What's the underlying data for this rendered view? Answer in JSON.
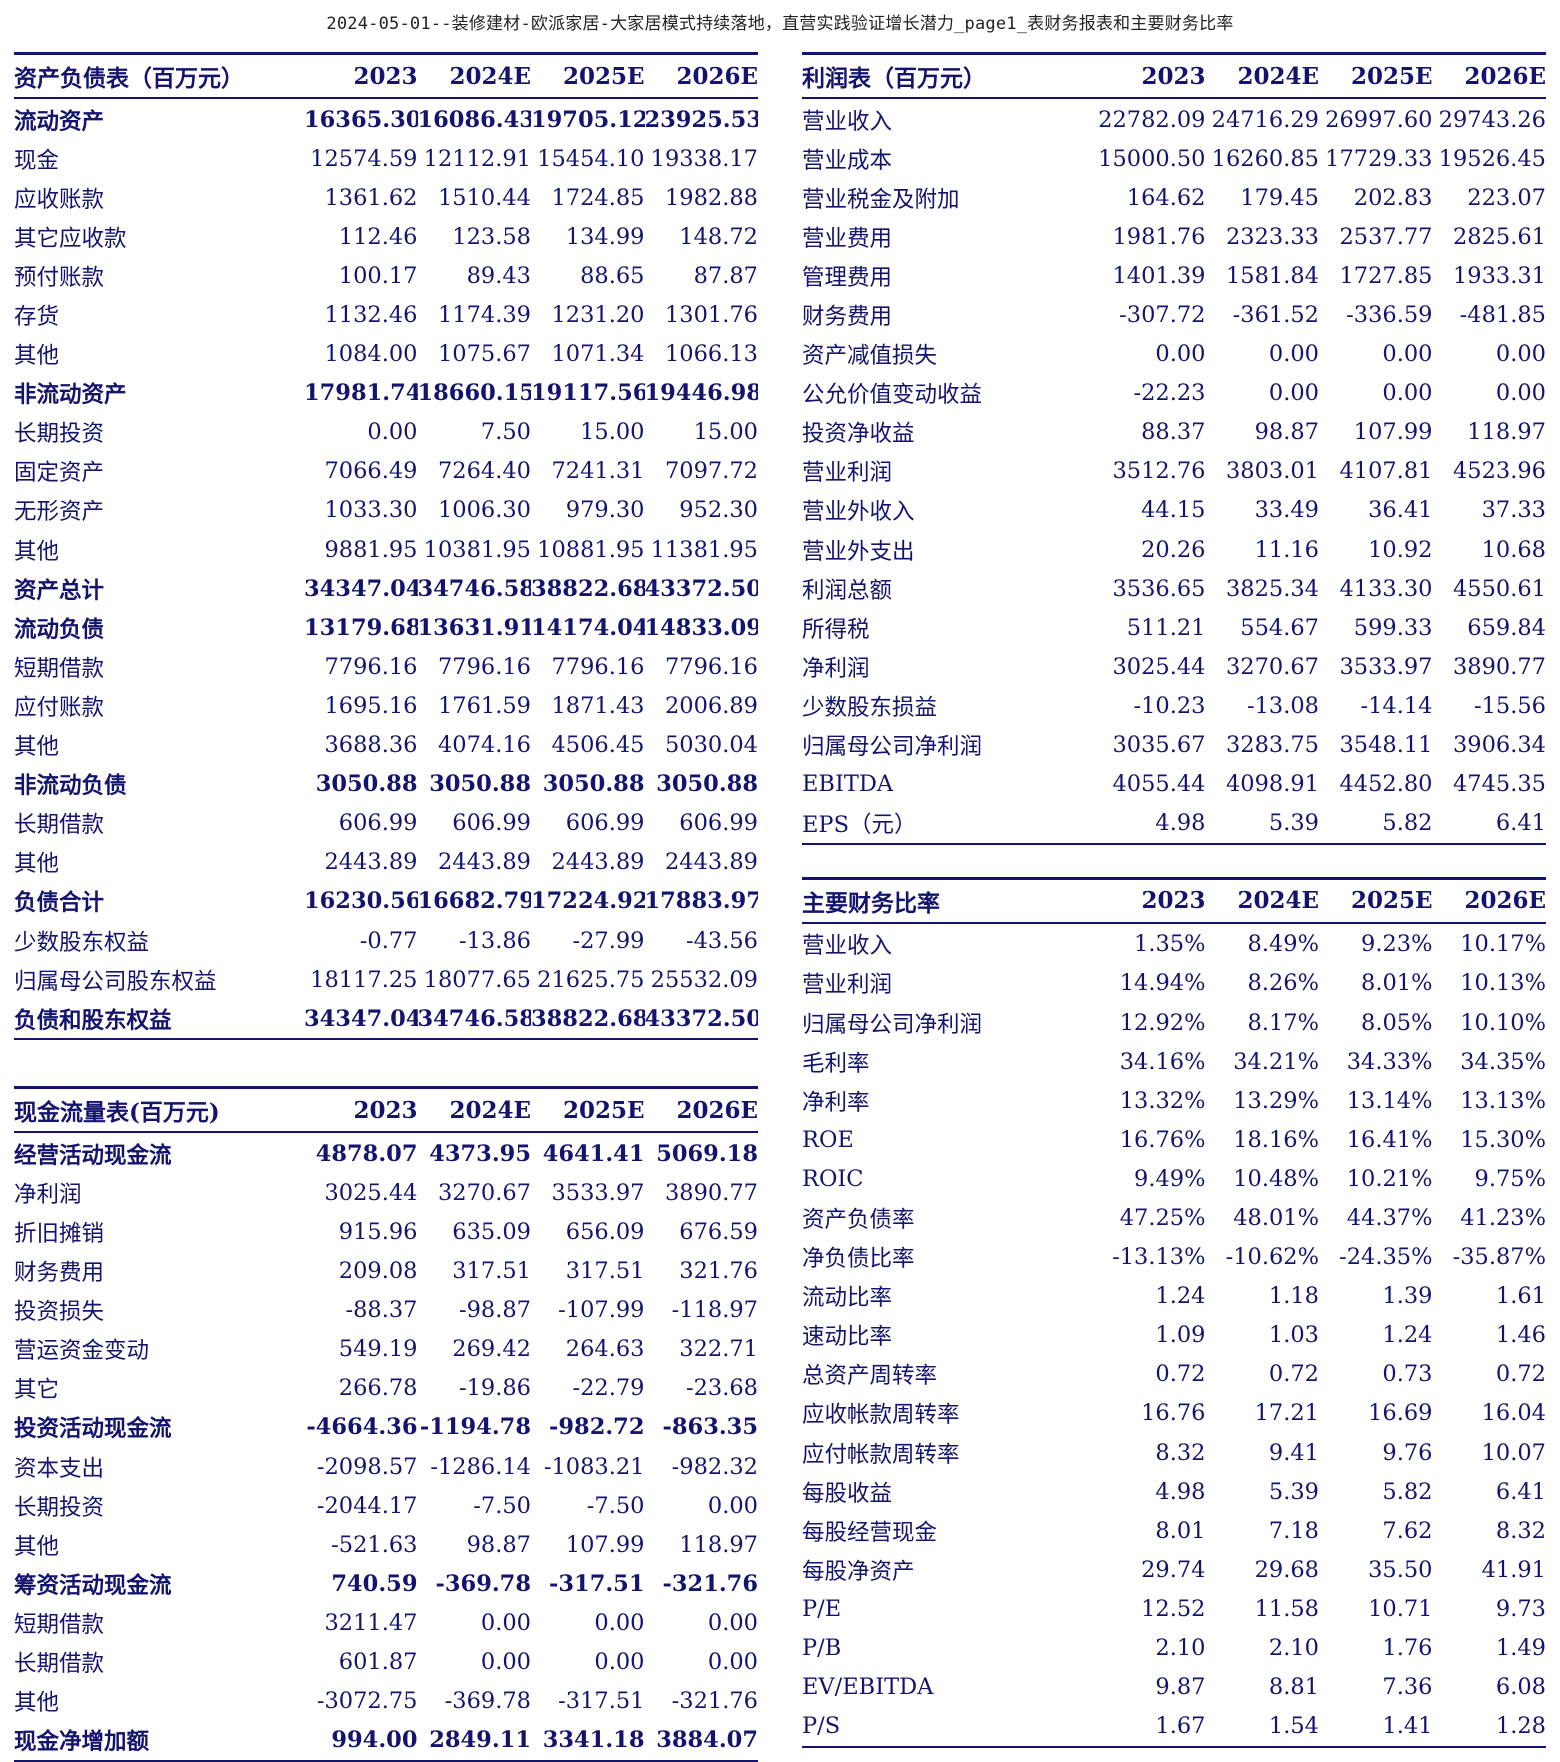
{
  "page_title": "2024-05-01--装修建材-欧派家居-大家居模式持续落地，直营实践验证增长潜力_page1_表财务报表和主要财务比率",
  "balance_sheet": {
    "title": "资产负债表（百万元）",
    "years": [
      "2023",
      "2024E",
      "2025E",
      "2026E"
    ],
    "rows": [
      {
        "label": "流动资产",
        "bold": true,
        "values": [
          "16365.30",
          "16086.43",
          "19705.12",
          "23925.53"
        ]
      },
      {
        "label": "现金",
        "bold": false,
        "values": [
          "12574.59",
          "12112.91",
          "15454.10",
          "19338.17"
        ]
      },
      {
        "label": "应收账款",
        "bold": false,
        "values": [
          "1361.62",
          "1510.44",
          "1724.85",
          "1982.88"
        ]
      },
      {
        "label": "其它应收款",
        "bold": false,
        "values": [
          "112.46",
          "123.58",
          "134.99",
          "148.72"
        ]
      },
      {
        "label": "预付账款",
        "bold": false,
        "values": [
          "100.17",
          "89.43",
          "88.65",
          "87.87"
        ]
      },
      {
        "label": "存货",
        "bold": false,
        "values": [
          "1132.46",
          "1174.39",
          "1231.20",
          "1301.76"
        ]
      },
      {
        "label": "其他",
        "bold": false,
        "values": [
          "1084.00",
          "1075.67",
          "1071.34",
          "1066.13"
        ]
      },
      {
        "label": "非流动资产",
        "bold": true,
        "values": [
          "17981.74",
          "18660.15",
          "19117.56",
          "19446.98"
        ]
      },
      {
        "label": "长期投资",
        "bold": false,
        "values": [
          "0.00",
          "7.50",
          "15.00",
          "15.00"
        ]
      },
      {
        "label": "固定资产",
        "bold": false,
        "values": [
          "7066.49",
          "7264.40",
          "7241.31",
          "7097.72"
        ]
      },
      {
        "label": "无形资产",
        "bold": false,
        "values": [
          "1033.30",
          "1006.30",
          "979.30",
          "952.30"
        ]
      },
      {
        "label": "其他",
        "bold": false,
        "values": [
          "9881.95",
          "10381.95",
          "10881.95",
          "11381.95"
        ]
      },
      {
        "label": "资产总计",
        "bold": true,
        "values": [
          "34347.04",
          "34746.58",
          "38822.68",
          "43372.50"
        ]
      },
      {
        "label": "流动负债",
        "bold": true,
        "values": [
          "13179.68",
          "13631.91",
          "14174.04",
          "14833.09"
        ]
      },
      {
        "label": "短期借款",
        "bold": false,
        "values": [
          "7796.16",
          "7796.16",
          "7796.16",
          "7796.16"
        ]
      },
      {
        "label": "应付账款",
        "bold": false,
        "values": [
          "1695.16",
          "1761.59",
          "1871.43",
          "2006.89"
        ]
      },
      {
        "label": "其他",
        "bold": false,
        "values": [
          "3688.36",
          "4074.16",
          "4506.45",
          "5030.04"
        ]
      },
      {
        "label": "非流动负债",
        "bold": true,
        "values": [
          "3050.88",
          "3050.88",
          "3050.88",
          "3050.88"
        ]
      },
      {
        "label": "长期借款",
        "bold": false,
        "values": [
          "606.99",
          "606.99",
          "606.99",
          "606.99"
        ]
      },
      {
        "label": "其他",
        "bold": false,
        "values": [
          "2443.89",
          "2443.89",
          "2443.89",
          "2443.89"
        ]
      },
      {
        "label": "负债合计",
        "bold": true,
        "values": [
          "16230.56",
          "16682.79",
          "17224.92",
          "17883.97"
        ]
      },
      {
        "label": "少数股东权益",
        "bold": false,
        "values": [
          "-0.77",
          "-13.86",
          "-27.99",
          "-43.56"
        ]
      },
      {
        "label": "归属母公司股东权益",
        "bold": false,
        "values": [
          "18117.25",
          "18077.65",
          "21625.75",
          "25532.09"
        ]
      },
      {
        "label": "负债和股东权益",
        "bold": true,
        "values": [
          "34347.04",
          "34746.58",
          "38822.68",
          "43372.50"
        ]
      }
    ]
  },
  "cash_flow": {
    "title": "现金流量表(百万元)",
    "years": [
      "2023",
      "2024E",
      "2025E",
      "2026E"
    ],
    "rows": [
      {
        "label": "经营活动现金流",
        "bold": true,
        "values": [
          "4878.07",
          "4373.95",
          "4641.41",
          "5069.18"
        ]
      },
      {
        "label": "净利润",
        "bold": false,
        "values": [
          "3025.44",
          "3270.67",
          "3533.97",
          "3890.77"
        ]
      },
      {
        "label": "折旧摊销",
        "bold": false,
        "values": [
          "915.96",
          "635.09",
          "656.09",
          "676.59"
        ]
      },
      {
        "label": "财务费用",
        "bold": false,
        "values": [
          "209.08",
          "317.51",
          "317.51",
          "321.76"
        ]
      },
      {
        "label": "投资损失",
        "bold": false,
        "values": [
          "-88.37",
          "-98.87",
          "-107.99",
          "-118.97"
        ]
      },
      {
        "label": "营运资金变动",
        "bold": false,
        "values": [
          "549.19",
          "269.42",
          "264.63",
          "322.71"
        ]
      },
      {
        "label": "其它",
        "bold": false,
        "values": [
          "266.78",
          "-19.86",
          "-22.79",
          "-23.68"
        ]
      },
      {
        "label": "投资活动现金流",
        "bold": true,
        "values": [
          "-4664.36",
          "-1194.78",
          "-982.72",
          "-863.35"
        ]
      },
      {
        "label": "资本支出",
        "bold": false,
        "values": [
          "-2098.57",
          "-1286.14",
          "-1083.21",
          "-982.32"
        ]
      },
      {
        "label": "长期投资",
        "bold": false,
        "values": [
          "-2044.17",
          "-7.50",
          "-7.50",
          "0.00"
        ]
      },
      {
        "label": "其他",
        "bold": false,
        "values": [
          "-521.63",
          "98.87",
          "107.99",
          "118.97"
        ]
      },
      {
        "label": "筹资活动现金流",
        "bold": true,
        "values": [
          "740.59",
          "-369.78",
          "-317.51",
          "-321.76"
        ]
      },
      {
        "label": "短期借款",
        "bold": false,
        "values": [
          "3211.47",
          "0.00",
          "0.00",
          "0.00"
        ]
      },
      {
        "label": "长期借款",
        "bold": false,
        "values": [
          "601.87",
          "0.00",
          "0.00",
          "0.00"
        ]
      },
      {
        "label": "其他",
        "bold": false,
        "values": [
          "-3072.75",
          "-369.78",
          "-317.51",
          "-321.76"
        ]
      },
      {
        "label": "现金净增加额",
        "bold": true,
        "values": [
          "994.00",
          "2849.11",
          "3341.18",
          "3884.07"
        ]
      }
    ]
  },
  "income_statement": {
    "title": "利润表（百万元）",
    "years": [
      "2023",
      "2024E",
      "2025E",
      "2026E"
    ],
    "rows": [
      {
        "label": "营业收入",
        "bold": false,
        "values": [
          "22782.09",
          "24716.29",
          "26997.60",
          "29743.26"
        ]
      },
      {
        "label": "营业成本",
        "bold": false,
        "values": [
          "15000.50",
          "16260.85",
          "17729.33",
          "19526.45"
        ]
      },
      {
        "label": "营业税金及附加",
        "bold": false,
        "values": [
          "164.62",
          "179.45",
          "202.83",
          "223.07"
        ]
      },
      {
        "label": "营业费用",
        "bold": false,
        "values": [
          "1981.76",
          "2323.33",
          "2537.77",
          "2825.61"
        ]
      },
      {
        "label": "管理费用",
        "bold": false,
        "values": [
          "1401.39",
          "1581.84",
          "1727.85",
          "1933.31"
        ]
      },
      {
        "label": "财务费用",
        "bold": false,
        "values": [
          "-307.72",
          "-361.52",
          "-336.59",
          "-481.85"
        ]
      },
      {
        "label": "资产减值损失",
        "bold": false,
        "values": [
          "0.00",
          "0.00",
          "0.00",
          "0.00"
        ]
      },
      {
        "label": "公允价值变动收益",
        "bold": false,
        "values": [
          "-22.23",
          "0.00",
          "0.00",
          "0.00"
        ]
      },
      {
        "label": "投资净收益",
        "bold": false,
        "values": [
          "88.37",
          "98.87",
          "107.99",
          "118.97"
        ]
      },
      {
        "label": "营业利润",
        "bold": false,
        "values": [
          "3512.76",
          "3803.01",
          "4107.81",
          "4523.96"
        ]
      },
      {
        "label": "营业外收入",
        "bold": false,
        "values": [
          "44.15",
          "33.49",
          "36.41",
          "37.33"
        ]
      },
      {
        "label": "营业外支出",
        "bold": false,
        "values": [
          "20.26",
          "11.16",
          "10.92",
          "10.68"
        ]
      },
      {
        "label": "利润总额",
        "bold": false,
        "values": [
          "3536.65",
          "3825.34",
          "4133.30",
          "4550.61"
        ]
      },
      {
        "label": "所得税",
        "bold": false,
        "values": [
          "511.21",
          "554.67",
          "599.33",
          "659.84"
        ]
      },
      {
        "label": "净利润",
        "bold": false,
        "values": [
          "3025.44",
          "3270.67",
          "3533.97",
          "3890.77"
        ]
      },
      {
        "label": "少数股东损益",
        "bold": false,
        "values": [
          "-10.23",
          "-13.08",
          "-14.14",
          "-15.56"
        ]
      },
      {
        "label": "归属母公司净利润",
        "bold": false,
        "values": [
          "3035.67",
          "3283.75",
          "3548.11",
          "3906.34"
        ]
      },
      {
        "label": "EBITDA",
        "bold": false,
        "values": [
          "4055.44",
          "4098.91",
          "4452.80",
          "4745.35"
        ]
      },
      {
        "label": "EPS（元）",
        "bold": false,
        "values": [
          "4.98",
          "5.39",
          "5.82",
          "6.41"
        ]
      }
    ]
  },
  "ratios": {
    "title": "主要财务比率",
    "years": [
      "2023",
      "2024E",
      "2025E",
      "2026E"
    ],
    "rows": [
      {
        "label": "营业收入",
        "bold": false,
        "values": [
          "1.35%",
          "8.49%",
          "9.23%",
          "10.17%"
        ]
      },
      {
        "label": "营业利润",
        "bold": false,
        "values": [
          "14.94%",
          "8.26%",
          "8.01%",
          "10.13%"
        ]
      },
      {
        "label": "归属母公司净利润",
        "bold": false,
        "values": [
          "12.92%",
          "8.17%",
          "8.05%",
          "10.10%"
        ]
      },
      {
        "label": "毛利率",
        "bold": false,
        "values": [
          "34.16%",
          "34.21%",
          "34.33%",
          "34.35%"
        ]
      },
      {
        "label": "净利率",
        "bold": false,
        "values": [
          "13.32%",
          "13.29%",
          "13.14%",
          "13.13%"
        ]
      },
      {
        "label": "ROE",
        "bold": false,
        "values": [
          "16.76%",
          "18.16%",
          "16.41%",
          "15.30%"
        ]
      },
      {
        "label": "ROIC",
        "bold": false,
        "values": [
          "9.49%",
          "10.48%",
          "10.21%",
          "9.75%"
        ]
      },
      {
        "label": "资产负债率",
        "bold": false,
        "values": [
          "47.25%",
          "48.01%",
          "44.37%",
          "41.23%"
        ]
      },
      {
        "label": "净负债比率",
        "bold": false,
        "values": [
          "-13.13%",
          "-10.62%",
          "-24.35%",
          "-35.87%"
        ]
      },
      {
        "label": "流动比率",
        "bold": false,
        "values": [
          "1.24",
          "1.18",
          "1.39",
          "1.61"
        ]
      },
      {
        "label": "速动比率",
        "bold": false,
        "values": [
          "1.09",
          "1.03",
          "1.24",
          "1.46"
        ]
      },
      {
        "label": "总资产周转率",
        "bold": false,
        "values": [
          "0.72",
          "0.72",
          "0.73",
          "0.72"
        ]
      },
      {
        "label": "应收帐款周转率",
        "bold": false,
        "values": [
          "16.76",
          "17.21",
          "16.69",
          "16.04"
        ]
      },
      {
        "label": "应付帐款周转率",
        "bold": false,
        "values": [
          "8.32",
          "9.41",
          "9.76",
          "10.07"
        ]
      },
      {
        "label": "每股收益",
        "bold": false,
        "values": [
          "4.98",
          "5.39",
          "5.82",
          "6.41"
        ]
      },
      {
        "label": "每股经营现金",
        "bold": false,
        "values": [
          "8.01",
          "7.18",
          "7.62",
          "8.32"
        ]
      },
      {
        "label": "每股净资产",
        "bold": false,
        "values": [
          "29.74",
          "29.68",
          "35.50",
          "41.91"
        ]
      },
      {
        "label": "P/E",
        "bold": false,
        "values": [
          "12.52",
          "11.58",
          "10.71",
          "9.73"
        ]
      },
      {
        "label": "P/B",
        "bold": false,
        "values": [
          "2.10",
          "2.10",
          "1.76",
          "1.49"
        ]
      },
      {
        "label": "EV/EBITDA",
        "bold": false,
        "values": [
          "9.87",
          "8.81",
          "7.36",
          "6.08"
        ]
      },
      {
        "label": "P/S",
        "bold": false,
        "values": [
          "1.67",
          "1.54",
          "1.41",
          "1.28"
        ]
      }
    ]
  }
}
